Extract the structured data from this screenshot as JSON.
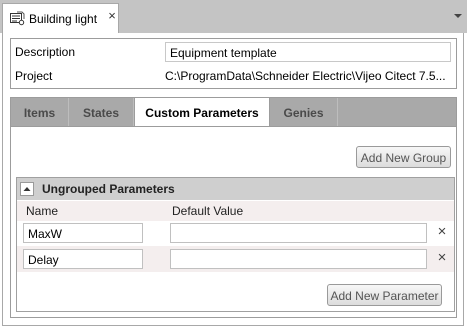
{
  "document_tab": {
    "title": "Building light",
    "icon": "template-icon",
    "close_glyph": "×"
  },
  "tabstrip": {
    "dropdown_icon": "chevron-down-icon"
  },
  "info": {
    "description_label": "Description",
    "description_value": "Equipment template",
    "project_label": "Project",
    "project_value": "C:\\ProgramData\\Schneider Electric\\Vijeo Citect 7.5..."
  },
  "section_tabs": [
    {
      "label": "Items",
      "active": false
    },
    {
      "label": "States",
      "active": false
    },
    {
      "label": "Custom Parameters",
      "active": true
    },
    {
      "label": "Genies",
      "active": false
    }
  ],
  "buttons": {
    "add_group": "Add New Group",
    "add_parameter": "Add New Parameter"
  },
  "group": {
    "title": "Ungrouped Parameters",
    "collapse_icon": "chevron-up-icon",
    "columns": {
      "name": "Name",
      "default_value": "Default Value"
    },
    "parameters": [
      {
        "name": "MaxW",
        "default_value": "",
        "delete_glyph": "×"
      },
      {
        "name": "Delay",
        "default_value": "",
        "delete_glyph": "×"
      }
    ]
  },
  "colors": {
    "tabstrip_bg": "#c4c4c4",
    "section_tab_bar_bg": "#a9a9a9",
    "group_header_bg": "#cfcfcf",
    "row_tint": "#f4eeee"
  }
}
